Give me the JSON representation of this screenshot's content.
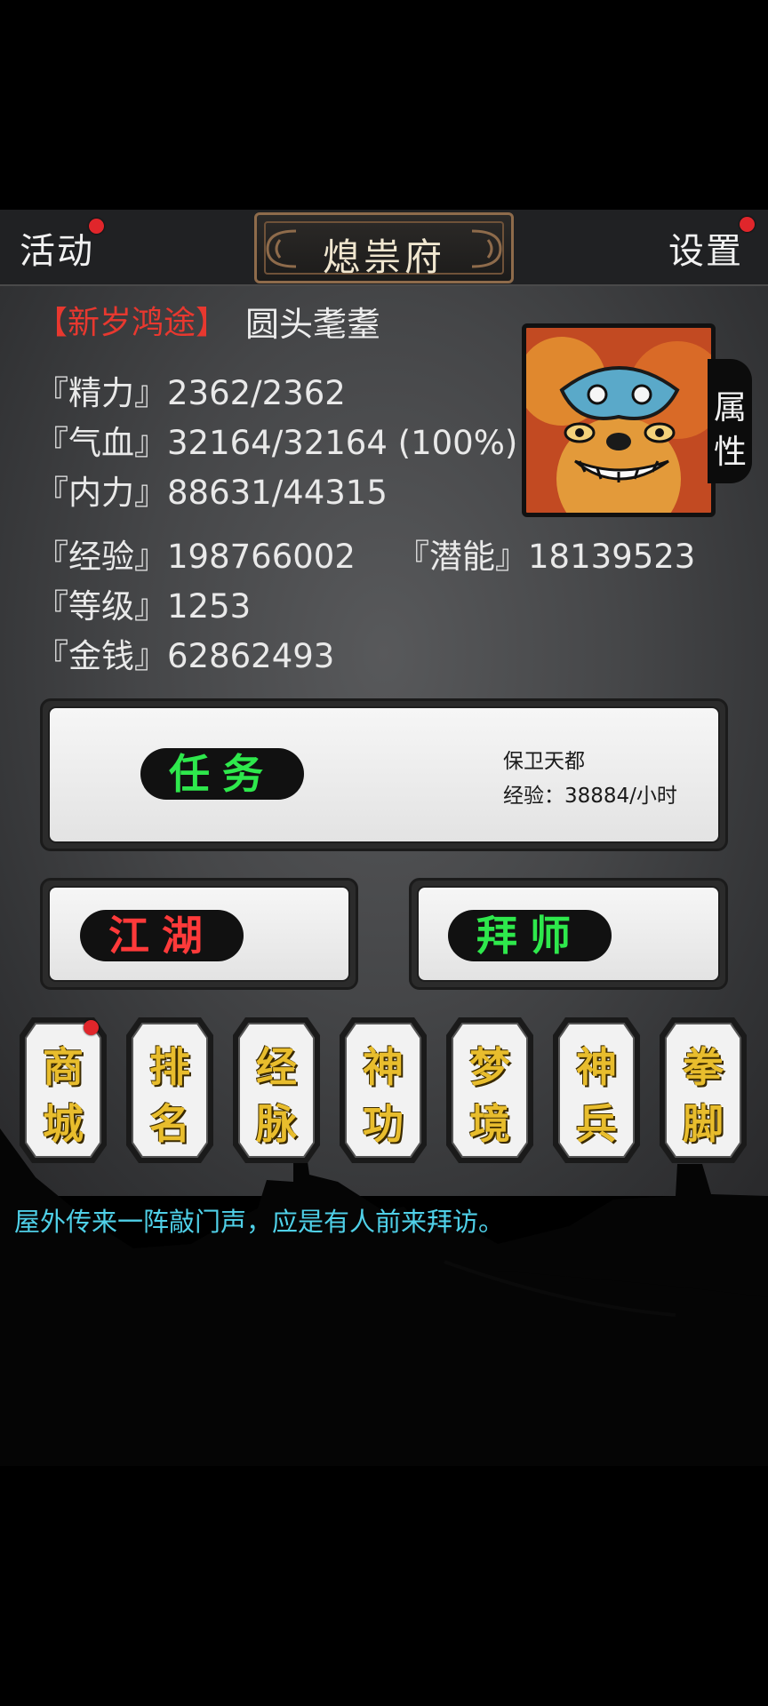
{
  "header": {
    "left_button": "活动",
    "title": "熄祟府",
    "right_button": "设置"
  },
  "player": {
    "event_tag": "【新岁鸿途】",
    "name": "圆头耄耋",
    "attr_tab": [
      "属",
      "性"
    ]
  },
  "stats": {
    "energy": "『精力』2362/2362",
    "hp": "『气血』32164/32164 (100%)",
    "internal": "『内力』88631/44315",
    "exp": "『经验』198766002",
    "potential": "『潜能』18139523",
    "level": "『等级』1253",
    "money": "『金钱』62862493"
  },
  "quest": {
    "button": "任务",
    "name": "保卫天都",
    "rate": "经验：38884/小时"
  },
  "actions": {
    "jianghu": "江湖",
    "baishi": "拜师"
  },
  "menu": [
    {
      "top": "商",
      "bottom": "城"
    },
    {
      "top": "排",
      "bottom": "名"
    },
    {
      "top": "经",
      "bottom": "脉"
    },
    {
      "top": "神",
      "bottom": "功"
    },
    {
      "top": "梦",
      "bottom": "境"
    },
    {
      "top": "神",
      "bottom": "兵"
    },
    {
      "top": "拳",
      "bottom": "脚"
    }
  ],
  "message": "屋外传来一阵敲门声，应是有人前来拜访。",
  "colors": {
    "notification": "#e0262b",
    "event_tag": "#e8382f",
    "menu_text": "#e8bd2d",
    "message": "#4fd0e8",
    "green_label": "#2ee84c",
    "red_label": "#ff3a3a"
  }
}
